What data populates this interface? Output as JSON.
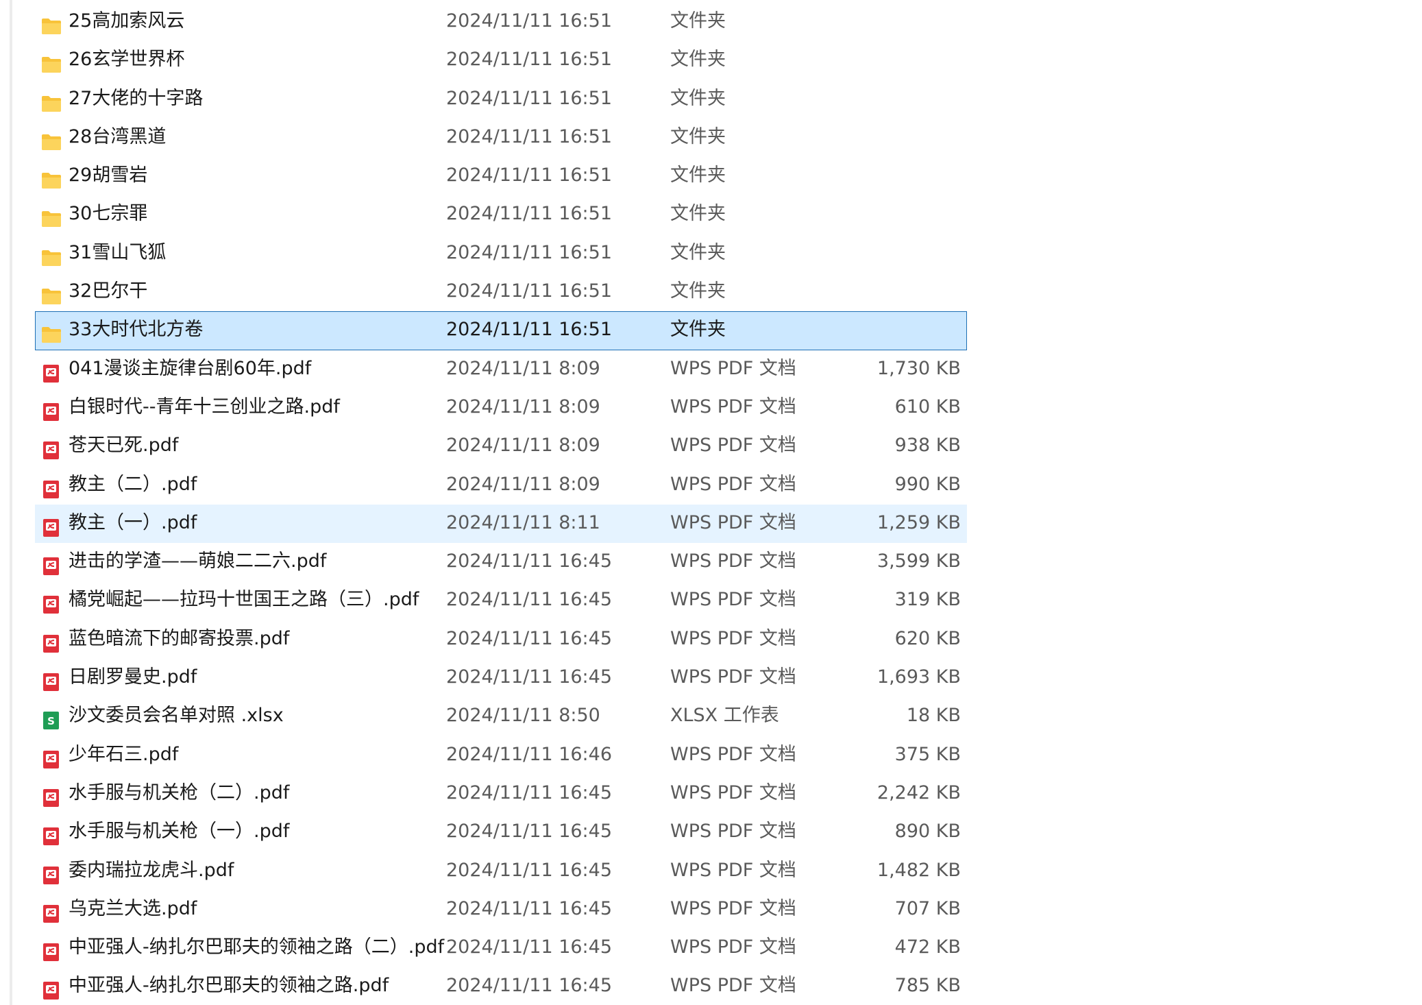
{
  "files": [
    {
      "name": "25高加索风云",
      "date": "2024/11/11 16:51",
      "type": "文件夹",
      "size": "",
      "icon": "folder-icon",
      "state": ""
    },
    {
      "name": "26玄学世界杯",
      "date": "2024/11/11 16:51",
      "type": "文件夹",
      "size": "",
      "icon": "folder-icon",
      "state": ""
    },
    {
      "name": "27大佬的十字路",
      "date": "2024/11/11 16:51",
      "type": "文件夹",
      "size": "",
      "icon": "folder-icon",
      "state": ""
    },
    {
      "name": "28台湾黑道",
      "date": "2024/11/11 16:51",
      "type": "文件夹",
      "size": "",
      "icon": "folder-icon",
      "state": ""
    },
    {
      "name": "29胡雪岩",
      "date": "2024/11/11 16:51",
      "type": "文件夹",
      "size": "",
      "icon": "folder-icon",
      "state": ""
    },
    {
      "name": "30七宗罪",
      "date": "2024/11/11 16:51",
      "type": "文件夹",
      "size": "",
      "icon": "folder-icon",
      "state": ""
    },
    {
      "name": "31雪山飞狐",
      "date": "2024/11/11 16:51",
      "type": "文件夹",
      "size": "",
      "icon": "folder-icon",
      "state": ""
    },
    {
      "name": "32巴尔干",
      "date": "2024/11/11 16:51",
      "type": "文件夹",
      "size": "",
      "icon": "folder-icon",
      "state": ""
    },
    {
      "name": "33大时代北方卷",
      "date": "2024/11/11 16:51",
      "type": "文件夹",
      "size": "",
      "icon": "folder-icon",
      "state": "selected"
    },
    {
      "name": "041漫谈主旋律台剧60年.pdf",
      "date": "2024/11/11 8:09",
      "type": "WPS PDF 文档",
      "size": "1,730 KB",
      "icon": "pdf-icon",
      "state": ""
    },
    {
      "name": "白银时代--青年十三创业之路.pdf",
      "date": "2024/11/11 8:09",
      "type": "WPS PDF 文档",
      "size": "610 KB",
      "icon": "pdf-icon",
      "state": ""
    },
    {
      "name": "苍天已死.pdf",
      "date": "2024/11/11 8:09",
      "type": "WPS PDF 文档",
      "size": "938 KB",
      "icon": "pdf-icon",
      "state": ""
    },
    {
      "name": "教主（二）.pdf",
      "date": "2024/11/11 8:09",
      "type": "WPS PDF 文档",
      "size": "990 KB",
      "icon": "pdf-icon",
      "state": ""
    },
    {
      "name": "教主（一）.pdf",
      "date": "2024/11/11 8:11",
      "type": "WPS PDF 文档",
      "size": "1,259 KB",
      "icon": "pdf-icon",
      "state": "hover"
    },
    {
      "name": "进击的学渣——萌娘二二六.pdf",
      "date": "2024/11/11 16:45",
      "type": "WPS PDF 文档",
      "size": "3,599 KB",
      "icon": "pdf-icon",
      "state": ""
    },
    {
      "name": "橘党崛起——拉玛十世国王之路（三）.pdf",
      "date": "2024/11/11 16:45",
      "type": "WPS PDF 文档",
      "size": "319 KB",
      "icon": "pdf-icon",
      "state": ""
    },
    {
      "name": "蓝色暗流下的邮寄投票.pdf",
      "date": "2024/11/11 16:45",
      "type": "WPS PDF 文档",
      "size": "620 KB",
      "icon": "pdf-icon",
      "state": ""
    },
    {
      "name": "日剧罗曼史.pdf",
      "date": "2024/11/11 16:45",
      "type": "WPS PDF 文档",
      "size": "1,693 KB",
      "icon": "pdf-icon",
      "state": ""
    },
    {
      "name": "沙文委员会名单对照 .xlsx",
      "date": "2024/11/11 8:50",
      "type": "XLSX 工作表",
      "size": "18 KB",
      "icon": "xlsx-icon",
      "state": ""
    },
    {
      "name": "少年石三.pdf",
      "date": "2024/11/11 16:46",
      "type": "WPS PDF 文档",
      "size": "375 KB",
      "icon": "pdf-icon",
      "state": ""
    },
    {
      "name": "水手服与机关枪（二）.pdf",
      "date": "2024/11/11 16:45",
      "type": "WPS PDF 文档",
      "size": "2,242 KB",
      "icon": "pdf-icon",
      "state": ""
    },
    {
      "name": "水手服与机关枪（一）.pdf",
      "date": "2024/11/11 16:45",
      "type": "WPS PDF 文档",
      "size": "890 KB",
      "icon": "pdf-icon",
      "state": ""
    },
    {
      "name": "委内瑞拉龙虎斗.pdf",
      "date": "2024/11/11 16:45",
      "type": "WPS PDF 文档",
      "size": "1,482 KB",
      "icon": "pdf-icon",
      "state": ""
    },
    {
      "name": "乌克兰大选.pdf",
      "date": "2024/11/11 16:45",
      "type": "WPS PDF 文档",
      "size": "707 KB",
      "icon": "pdf-icon",
      "state": ""
    },
    {
      "name": "中亚强人-纳扎尔巴耶夫的领袖之路（二）.pdf",
      "date": "2024/11/11 16:45",
      "type": "WPS PDF 文档",
      "size": "472 KB",
      "icon": "pdf-icon",
      "state": ""
    },
    {
      "name": "中亚强人-纳扎尔巴耶夫的领袖之路.pdf",
      "date": "2024/11/11 16:45",
      "type": "WPS PDF 文档",
      "size": "785 KB",
      "icon": "pdf-icon",
      "state": ""
    }
  ],
  "colors": {
    "selected_bg": "#cce8ff",
    "selected_border": "#1d6fb5",
    "hover_bg": "#e5f3ff",
    "folder": "#f8c33a",
    "pdf": "#e0303a",
    "xlsx": "#1f9d55"
  }
}
